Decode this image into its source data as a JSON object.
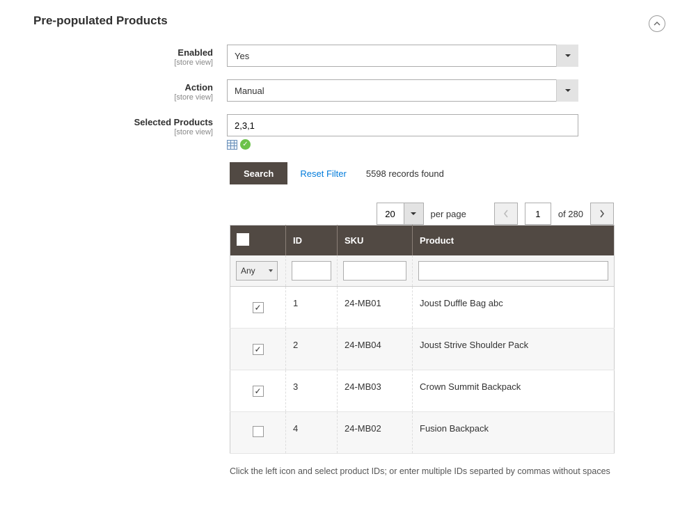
{
  "section": {
    "title": "Pre-populated Products"
  },
  "fields": {
    "enabled": {
      "label": "Enabled",
      "scope": "[store view]",
      "value": "Yes"
    },
    "action": {
      "label": "Action",
      "scope": "[store view]",
      "value": "Manual"
    },
    "selected": {
      "label": "Selected Products",
      "scope": "[store view]",
      "value": "2,3,1"
    }
  },
  "toolbar": {
    "search_label": "Search",
    "reset_label": "Reset Filter",
    "records_found": "5598 records found"
  },
  "pager": {
    "page_size": "20",
    "per_page_label": "per page",
    "current_page": "1",
    "of_pages_label": "of 280"
  },
  "columns": {
    "id": "ID",
    "sku": "SKU",
    "product": "Product"
  },
  "filter": {
    "chk": "Any"
  },
  "rows": [
    {
      "checked": true,
      "id": "1",
      "sku": "24-MB01",
      "product": "Joust Duffle Bag abc"
    },
    {
      "checked": true,
      "id": "2",
      "sku": "24-MB04",
      "product": "Joust Strive Shoulder Pack"
    },
    {
      "checked": true,
      "id": "3",
      "sku": "24-MB03",
      "product": "Crown Summit Backpack"
    },
    {
      "checked": false,
      "id": "4",
      "sku": "24-MB02",
      "product": "Fusion Backpack"
    }
  ],
  "help": "Click the left icon and select product IDs; or enter multiple IDs separted by commas without spaces"
}
